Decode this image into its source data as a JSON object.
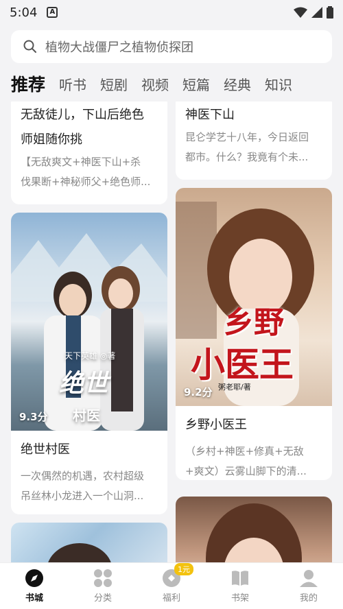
{
  "status": {
    "time": "5:04",
    "notif_icon": "A"
  },
  "search": {
    "placeholder": "植物大战僵尸之植物侦探团"
  },
  "tabs": [
    {
      "label": "推荐",
      "active": true
    },
    {
      "label": "听书"
    },
    {
      "label": "短剧"
    },
    {
      "label": "视频"
    },
    {
      "label": "短篇"
    },
    {
      "label": "经典"
    },
    {
      "label": "知识"
    }
  ],
  "books": [
    {
      "title_l1": "无敌徒儿，下山后绝色",
      "title_l2": "师姐随你挑",
      "desc_l1": "【无敌爽文+神医下山+杀",
      "desc_l2": "伐果断+神秘师父+绝色师..."
    },
    {
      "title": "神医下山",
      "desc_l1": "昆仑学艺十八年，今日返回",
      "desc_l2": "都市。什么？我竟有个未..."
    },
    {
      "title": "绝世村医",
      "score": "9.3分",
      "cover_text_1": "绝世",
      "cover_text_2": "村医",
      "cover_author": "天下英雄 ◎著",
      "desc_l1": "一次偶然的机遇，农村超级",
      "desc_l2": "吊丝林小龙进入一个山洞..."
    },
    {
      "title": "乡野小医王",
      "score": "9.2分",
      "cover_text_1": "乡野",
      "cover_text_2": "小医王",
      "cover_author": "粥老耶/著",
      "desc_l1": "（乡村+神医+修真+无敌",
      "desc_l2": "+爽文）云雾山脚下的清..."
    }
  ],
  "nav": [
    {
      "label": "书城",
      "icon": "compass-icon",
      "active": true
    },
    {
      "label": "分类",
      "icon": "grid-icon"
    },
    {
      "label": "福利",
      "icon": "coin-icon",
      "badge": "1元"
    },
    {
      "label": "书架",
      "icon": "book-icon"
    },
    {
      "label": "我的",
      "icon": "person-icon"
    }
  ],
  "colors": {
    "accent": "#111111",
    "badge": "#f3c20f",
    "background": "#f3f3f5"
  }
}
